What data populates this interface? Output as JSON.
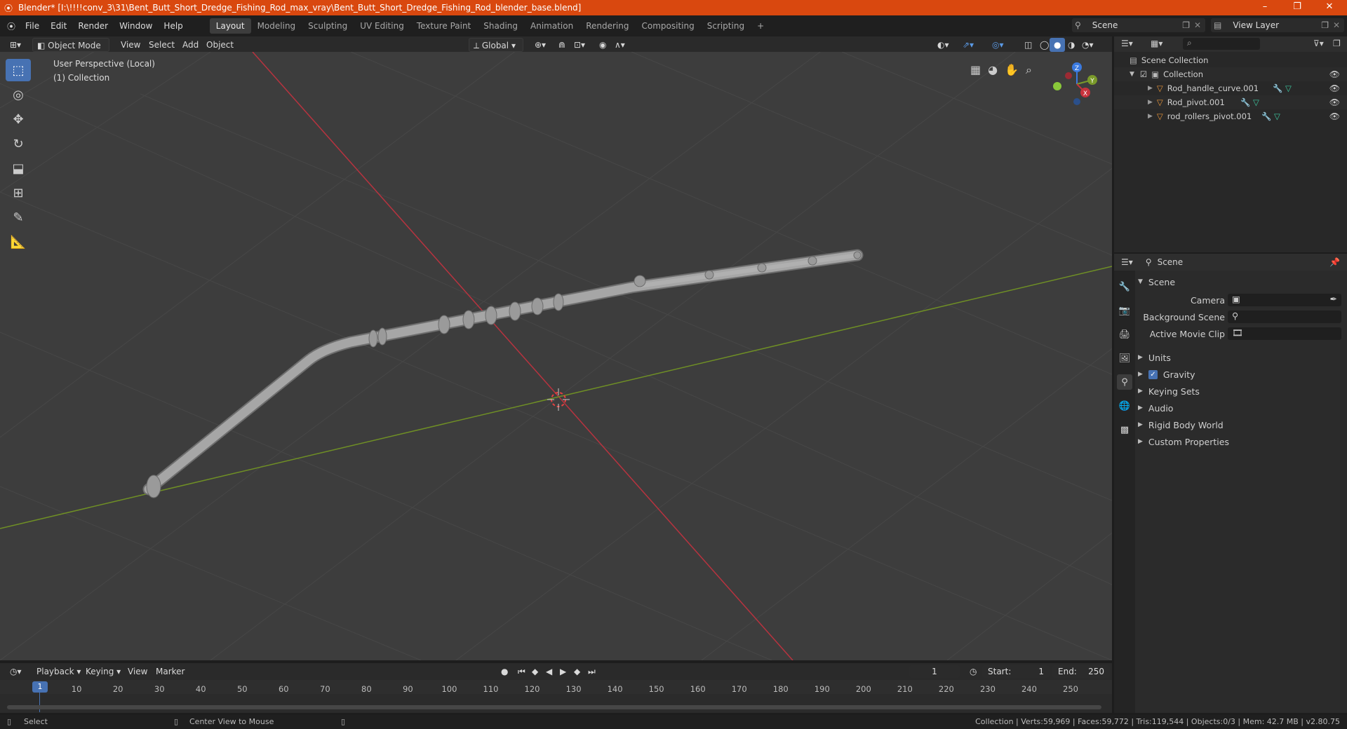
{
  "window": {
    "title": "Blender* [I:\\!!!!conv_3\\31\\Bent_Butt_Short_Dredge_Fishing_Rod_max_vray\\Bent_Butt_Short_Dredge_Fishing_Rod_blender_base.blend]",
    "minimize": "–",
    "maximize": "❐",
    "close": "✕"
  },
  "menu": [
    "File",
    "Edit",
    "Render",
    "Window",
    "Help"
  ],
  "workspaces": [
    "Layout",
    "Modeling",
    "Sculpting",
    "UV Editing",
    "Texture Paint",
    "Shading",
    "Animation",
    "Rendering",
    "Compositing",
    "Scripting"
  ],
  "add_workspace": "+",
  "scene_field": "Scene",
  "view_layer_field": "View Layer",
  "viewport_header": {
    "mode": "Object Mode",
    "menus": [
      "View",
      "Select",
      "Add",
      "Object"
    ],
    "orientation": "Global"
  },
  "viewport": {
    "perspective": "User Perspective (Local)",
    "collection": "(1) Collection",
    "gizmo": {
      "x": "X",
      "y": "Y",
      "z": "Z"
    }
  },
  "outliner": {
    "root": "Scene Collection",
    "collection": "Collection",
    "objects": [
      "Rod_handle_curve.001",
      "Rod_pivot.001",
      "rod_rollers_pivot.001"
    ]
  },
  "properties": {
    "context": "Scene",
    "panel": "Scene",
    "fields": [
      {
        "label": "Camera",
        "value": ""
      },
      {
        "label": "Background Scene",
        "value": ""
      },
      {
        "label": "Active Movie Clip",
        "value": ""
      }
    ],
    "sections": [
      "Units",
      "Gravity",
      "Keying Sets",
      "Audio",
      "Rigid Body World",
      "Custom Properties"
    ]
  },
  "timeline": {
    "menus": [
      "Playback",
      "Keying",
      "View",
      "Marker"
    ],
    "current_frame": "1",
    "start_label": "Start:",
    "start": "1",
    "end_label": "End:",
    "end": "250",
    "ticks": [
      "1",
      "10",
      "20",
      "30",
      "40",
      "50",
      "60",
      "70",
      "80",
      "90",
      "100",
      "110",
      "120",
      "130",
      "140",
      "150",
      "160",
      "170",
      "180",
      "190",
      "200",
      "210",
      "220",
      "230",
      "240",
      "250"
    ]
  },
  "status": {
    "left1": "Select",
    "left2": "Center View to Mouse",
    "right": "Collection | Verts:59,969 | Faces:59,772 | Tris:119,544 | Objects:0/3 | Mem: 42.7 MB | v2.80.75"
  },
  "colors": {
    "accent": "#4772b3",
    "titlebar": "#d9480f",
    "x_axis": "#c8323c",
    "y_axis": "#7a9a2a",
    "z_axis": "#3a7ae0"
  }
}
